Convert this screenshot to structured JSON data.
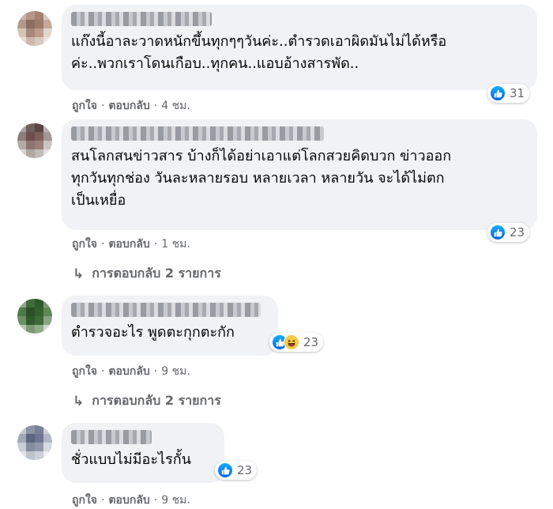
{
  "comments": [
    {
      "text": "แก๊งนี้อาละวาดหนักขึ้นทุกๆๆวันค่ะ..ตำรวดเอาผิดมันไม่ได้หรือ\nค่ะ..พวกเราโดนเกือบ..ทุกคน..แอบอ้างสารพัด..",
      "reaction_count": "31",
      "reactions": [
        "like-icon"
      ],
      "like": "ถูกใจ",
      "reply": "ตอบกลับ",
      "time": "4 ชม."
    },
    {
      "text": "สนโลกสนข่าวสาร บ้างก็ได้อย่าเอาแต่โลกสวยคิดบวก ข่าวออก\nทุกวันทุกช่อง วันละหลายรอบ หลายเวลา หลายวัน จะได้ไม่ตก\nเป็นเหยื่อ",
      "reaction_count": "23",
      "reactions": [
        "like-icon"
      ],
      "like": "ถูกใจ",
      "reply": "ตอบกลับ",
      "time": "1 ชม.",
      "replies_label": "การตอบกลับ 2 รายการ"
    },
    {
      "text": "ตำรวจอะไร พูดตะกุกตะกัก",
      "reaction_count": "23",
      "reactions": [
        "like-icon",
        "haha-icon"
      ],
      "like": "ถูกใจ",
      "reply": "ตอบกลับ",
      "time": "9 ชม.",
      "replies_label": "การตอบกลับ 2 รายการ"
    },
    {
      "text": "ชั่วแบบไม่มีอะไรกั้น",
      "reaction_count": "23",
      "reactions": [
        "like-icon"
      ],
      "like": "ถูกใจ",
      "reply": "ตอบกลับ",
      "time": "9 ชม."
    }
  ],
  "separator": "·",
  "reply_arrow": "↳",
  "colors": {
    "bubble": "#f0f2f5",
    "meta_text": "#65676b",
    "like_blue": "#1877f2",
    "haha_yellow": "#f7c94b"
  }
}
